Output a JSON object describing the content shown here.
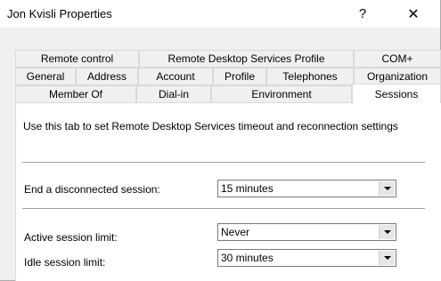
{
  "window": {
    "title": "Jon Kvisli Properties",
    "help_glyph": "?",
    "close_glyph": "✕"
  },
  "tabs": {
    "row1": [
      "Remote control",
      "Remote Desktop Services Profile",
      "COM+"
    ],
    "row2": [
      "General",
      "Address",
      "Account",
      "Profile",
      "Telephones",
      "Organization"
    ],
    "row3": [
      "Member Of",
      "Dial-in",
      "Environment",
      "Sessions"
    ],
    "active": "Sessions"
  },
  "sessions": {
    "description": "Use this tab to set Remote Desktop Services timeout and reconnection settings",
    "end_disconnected_label": "End a disconnected session:",
    "end_disconnected_value": "15 minutes",
    "active_limit_label": "Active session limit:",
    "active_limit_value": "Never",
    "idle_limit_label": "Idle session limit:",
    "idle_limit_value": "30 minutes"
  }
}
